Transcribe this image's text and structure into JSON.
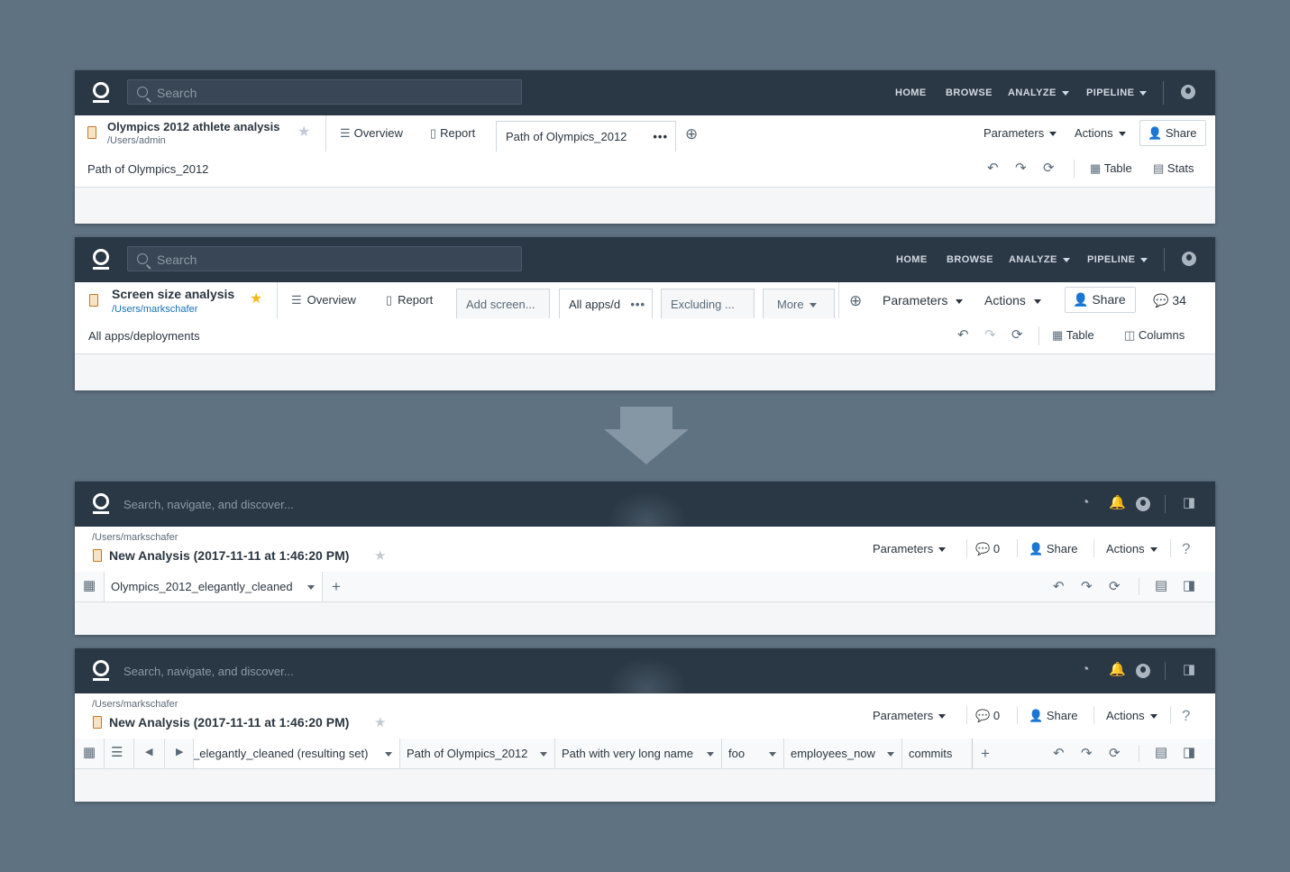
{
  "colors": {
    "background": "#5f7282",
    "topbar": "#2a3744",
    "link": "#1a6fb0",
    "star_active": "#f5b91e"
  },
  "panel1": {
    "search_placeholder": "Search",
    "nav": [
      "HOME",
      "BROWSE",
      "ANALYZE",
      "PIPELINE"
    ],
    "title": "Olympics 2012 athlete analysis",
    "path": "/Users/admin",
    "tabs": {
      "overview": "Overview",
      "report": "Report",
      "active": "Path of Olympics_2012"
    },
    "parameters": "Parameters",
    "actions": "Actions",
    "share": "Share",
    "subheader": "Path of Olympics_2012",
    "table": "Table",
    "stats": "Stats"
  },
  "panel2": {
    "search_placeholder": "Search",
    "nav": [
      "HOME",
      "BROWSE",
      "ANALYZE",
      "PIPELINE"
    ],
    "title": "Screen size analysis",
    "path": "/Users/markschafer",
    "tabs": {
      "overview": "Overview",
      "report": "Report",
      "add_screen": "Add screen...",
      "active": "All apps/d",
      "excluding": "Excluding ...",
      "more": "More"
    },
    "parameters": "Parameters",
    "actions": "Actions",
    "share": "Share",
    "comments": "34",
    "subheader": "All apps/deployments",
    "table": "Table",
    "columns": "Columns"
  },
  "panel3": {
    "search_placeholder": "Search, navigate, and discover...",
    "path": "/Users/markschafer",
    "title": "New Analysis (2017-11-11 at 1:46:20 PM)",
    "parameters": "Parameters",
    "comments": "0",
    "share": "Share",
    "actions": "Actions",
    "dataset": "Olympics_2012_elegantly_cleaned"
  },
  "panel4": {
    "search_placeholder": "Search, navigate, and discover...",
    "path": "/Users/markschafer",
    "title": "New Analysis (2017-11-11 at 1:46:20 PM)",
    "parameters": "Parameters",
    "comments": "0",
    "share": "Share",
    "actions": "Actions",
    "datasets": [
      "_elegantly_cleaned (resulting set)",
      "Path of Olympics_2012",
      "Path with very long name",
      "foo",
      "employees_now",
      "commits"
    ]
  }
}
